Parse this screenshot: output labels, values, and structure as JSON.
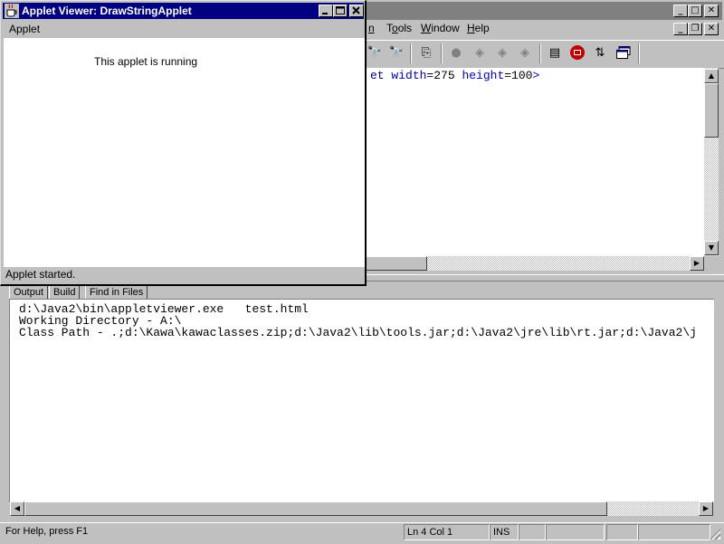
{
  "main_menu": {
    "items": [
      {
        "label_prefix": "",
        "mnemonic": "n",
        "label_suffix": ""
      },
      {
        "label_prefix": "T",
        "mnemonic": "o",
        "label_suffix": "ols"
      },
      {
        "label_prefix": "",
        "mnemonic": "W",
        "label_suffix": "indow"
      },
      {
        "label_prefix": "",
        "mnemonic": "H",
        "label_suffix": "elp"
      }
    ]
  },
  "editor": {
    "line_keyword1": "et",
    "line_attr1": " width",
    "line_val1": "=275 ",
    "line_attr2": "height",
    "line_val2": "=100",
    "line_end": ">"
  },
  "output": {
    "tabs": [
      "Output",
      "Build",
      "Find in Files"
    ],
    "lines": [
      "d:\\Java2\\bin\\appletviewer.exe   test.html",
      "Working Directory - A:\\",
      "Class Path - .;d:\\Kawa\\kawaclasses.zip;d:\\Java2\\lib\\tools.jar;d:\\Java2\\jre\\lib\\rt.jar;d:\\Java2\\j"
    ]
  },
  "statusbar": {
    "help": "For Help, press F1",
    "position": "Ln 4 Col 1",
    "mode": "INS"
  },
  "applet_window": {
    "title": "Applet Viewer: DrawStringApplet",
    "menu": "Applet",
    "content_text": "This applet is running",
    "status": "Applet started."
  },
  "colors": {
    "titlebar_active": "#000080",
    "editor_keyword": "#000080",
    "editor_attr": "#0000c0",
    "stop_icon": "#c00000"
  },
  "icons": {
    "window_controls": [
      "minimize-icon",
      "maximize-icon",
      "close-icon"
    ],
    "toolbar": [
      "find-icon",
      "find-next-icon",
      "compile-icon",
      "run-icon",
      "step-into-icon",
      "step-over-icon",
      "step-out-icon",
      "debug-icon",
      "stop-icon",
      "transfer-icon",
      "window-icon"
    ]
  }
}
